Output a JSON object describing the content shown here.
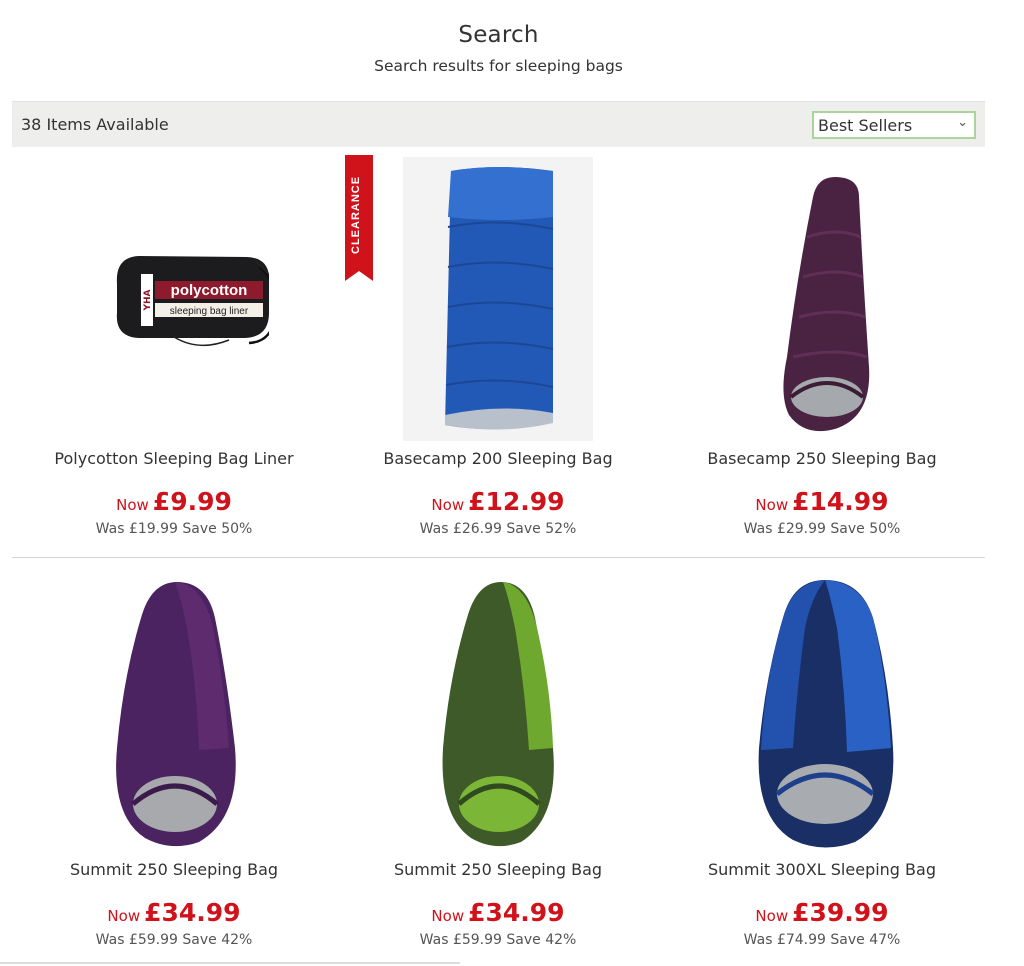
{
  "header": {
    "title": "Search",
    "subtitle": "Search results for sleeping bags"
  },
  "toolbar": {
    "count": "38 Items Available",
    "sort_selected": "Best Sellers",
    "sort_icon": "chevron-down-icon"
  },
  "badge": {
    "label": "CLEARANCE",
    "color": "#d0121b"
  },
  "colors": {
    "price": "#d0121b",
    "toolbar_bg": "#eeeeec",
    "select_border": "#a9d59c"
  },
  "products": [
    {
      "name": "Polycotton Sleeping Bag Liner",
      "now_label": "Now",
      "price": "£9.99",
      "was": "Was £19.99 Save 50%",
      "image": "sleeping-bag-liner",
      "liner_text": [
        "polycotton",
        "sleeping bag liner",
        "YHA"
      ]
    },
    {
      "name": "Basecamp 200 Sleeping Bag",
      "now_label": "Now",
      "price": "£12.99",
      "was": "Was £26.99 Save 52%",
      "image": "blue-rectangular-sleeping-bag"
    },
    {
      "name": "Basecamp 250 Sleeping Bag",
      "now_label": "Now",
      "price": "£14.99",
      "was": "Was £29.99 Save 50%",
      "image": "purple-mummy-sleeping-bag"
    },
    {
      "name": "Summit 250 Sleeping Bag",
      "now_label": "Now",
      "price": "£34.99",
      "was": "Was £59.99 Save 42%",
      "image": "purple-mummy-sleeping-bag"
    },
    {
      "name": "Summit 250 Sleeping Bag",
      "now_label": "Now",
      "price": "£34.99",
      "was": "Was £59.99 Save 42%",
      "image": "green-mummy-sleeping-bag"
    },
    {
      "name": "Summit 300XL Sleeping Bag",
      "now_label": "Now",
      "price": "£39.99",
      "was": "Was £74.99 Save 47%",
      "image": "blue-mummy-sleeping-bag"
    }
  ]
}
